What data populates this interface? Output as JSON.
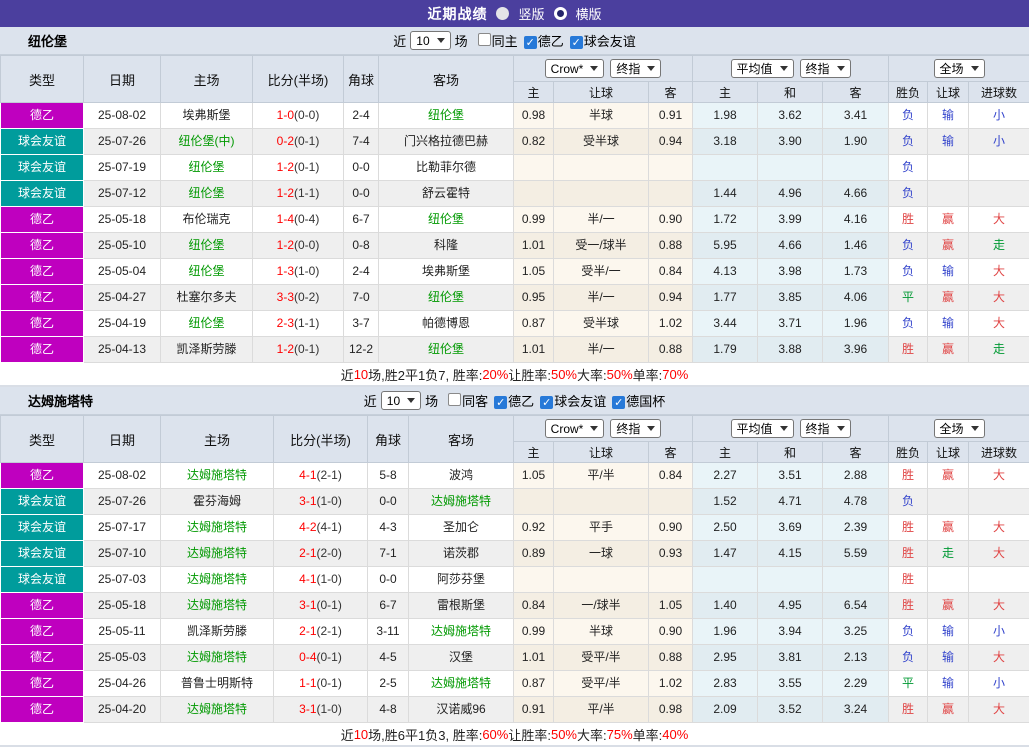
{
  "topbar": {
    "title": "近期战绩",
    "radios": [
      {
        "label": "竖版",
        "style": "solid"
      },
      {
        "label": "横版",
        "style": "ring"
      }
    ]
  },
  "colors": {
    "topbar_bg": "#4B3F9E",
    "league_badge": "#BF00BF",
    "friendly_badge": "#009C9C",
    "team_green": "#009900",
    "score_red": "#FF0000",
    "win_red": "#E04545",
    "lose_blue": "#3344CC",
    "draw_green": "#009933",
    "header_bg": "#DCE3ED",
    "odds_col_bg": "#FCF7EE",
    "avg_col_bg": "#E9F4F8"
  },
  "table_headers": {
    "left": [
      "类型",
      "日期",
      "主场",
      "比分(半场)",
      "角球",
      "客场"
    ],
    "odds_group": {
      "select1": "Crow*",
      "select2": "终指",
      "cols": [
        "主",
        "让球",
        "客"
      ]
    },
    "avg_group": {
      "select1": "平均值",
      "select2": "终指",
      "cols": [
        "主",
        "和",
        "客"
      ]
    },
    "result_group": {
      "select": "全场",
      "cols": [
        "胜负",
        "让球",
        "进球数"
      ]
    }
  },
  "sections": [
    {
      "title": "纽伦堡",
      "filter": {
        "prefix": "近",
        "count": "10",
        "suffix": "场",
        "checkboxes": [
          {
            "label": "同主",
            "checked": false
          },
          {
            "label": "德乙",
            "checked": true
          },
          {
            "label": "球会友谊",
            "checked": true
          }
        ]
      },
      "rows": [
        {
          "type": "德乙",
          "league_key": "league",
          "date": "25-08-02",
          "home": "埃弗斯堡",
          "home_active": false,
          "score": "1-0",
          "half": "(0-0)",
          "corners": "2-4",
          "away": "纽伦堡",
          "away_active": true,
          "odds": [
            "0.98",
            "半球",
            "0.91"
          ],
          "avgs": [
            "1.98",
            "3.62",
            "3.41"
          ],
          "results": [
            {
              "text": "负",
              "color": "blue"
            },
            {
              "text": "输",
              "color": "blue"
            },
            {
              "text": "小",
              "color": "blue"
            }
          ]
        },
        {
          "type": "球会友谊",
          "league_key": "friendly",
          "date": "25-07-26",
          "home": "纽伦堡(中)",
          "home_active": true,
          "score": "0-2",
          "half": "(0-1)",
          "corners": "7-4",
          "away": "门兴格拉德巴赫",
          "away_active": false,
          "odds": [
            "0.82",
            "受半球",
            "0.94"
          ],
          "avgs": [
            "3.18",
            "3.90",
            "1.90"
          ],
          "results": [
            {
              "text": "负",
              "color": "blue"
            },
            {
              "text": "输",
              "color": "blue"
            },
            {
              "text": "小",
              "color": "blue"
            }
          ]
        },
        {
          "type": "球会友谊",
          "league_key": "friendly",
          "date": "25-07-19",
          "home": "纽伦堡",
          "home_active": true,
          "score": "1-2",
          "half": "(0-1)",
          "corners": "0-0",
          "away": "比勒菲尔德",
          "away_active": false,
          "odds": [
            "",
            "",
            ""
          ],
          "avgs": [
            "",
            "",
            ""
          ],
          "results": [
            {
              "text": "负",
              "color": "blue"
            },
            {
              "text": "",
              "color": ""
            },
            {
              "text": "",
              "color": ""
            }
          ]
        },
        {
          "type": "球会友谊",
          "league_key": "friendly",
          "date": "25-07-12",
          "home": "纽伦堡",
          "home_active": true,
          "score": "1-2",
          "half": "(1-1)",
          "corners": "0-0",
          "away": "舒云霍特",
          "away_active": false,
          "odds": [
            "",
            "",
            ""
          ],
          "avgs": [
            "1.44",
            "4.96",
            "4.66"
          ],
          "results": [
            {
              "text": "负",
              "color": "blue"
            },
            {
              "text": "",
              "color": ""
            },
            {
              "text": "",
              "color": ""
            }
          ]
        },
        {
          "type": "德乙",
          "league_key": "league",
          "date": "25-05-18",
          "home": "布伦瑞克",
          "home_active": false,
          "score": "1-4",
          "half": "(0-4)",
          "corners": "6-7",
          "away": "纽伦堡",
          "away_active": true,
          "odds": [
            "0.99",
            "半/一",
            "0.90"
          ],
          "avgs": [
            "1.72",
            "3.99",
            "4.16"
          ],
          "results": [
            {
              "text": "胜",
              "color": "red"
            },
            {
              "text": "赢",
              "color": "red"
            },
            {
              "text": "大",
              "color": "red"
            }
          ]
        },
        {
          "type": "德乙",
          "league_key": "league",
          "date": "25-05-10",
          "home": "纽伦堡",
          "home_active": true,
          "score": "1-2",
          "half": "(0-0)",
          "corners": "0-8",
          "away": "科隆",
          "away_active": false,
          "odds": [
            "1.01",
            "受一/球半",
            "0.88"
          ],
          "avgs": [
            "5.95",
            "4.66",
            "1.46"
          ],
          "results": [
            {
              "text": "负",
              "color": "blue"
            },
            {
              "text": "赢",
              "color": "red"
            },
            {
              "text": "走",
              "color": "green"
            }
          ]
        },
        {
          "type": "德乙",
          "league_key": "league",
          "date": "25-05-04",
          "home": "纽伦堡",
          "home_active": true,
          "score": "1-3",
          "half": "(1-0)",
          "corners": "2-4",
          "away": "埃弗斯堡",
          "away_active": false,
          "odds": [
            "1.05",
            "受半/一",
            "0.84"
          ],
          "avgs": [
            "4.13",
            "3.98",
            "1.73"
          ],
          "results": [
            {
              "text": "负",
              "color": "blue"
            },
            {
              "text": "输",
              "color": "blue"
            },
            {
              "text": "大",
              "color": "red"
            }
          ]
        },
        {
          "type": "德乙",
          "league_key": "league",
          "date": "25-04-27",
          "home": "杜塞尔多夫",
          "home_active": false,
          "score": "3-3",
          "half": "(0-2)",
          "corners": "7-0",
          "away": "纽伦堡",
          "away_active": true,
          "odds": [
            "0.95",
            "半/一",
            "0.94"
          ],
          "avgs": [
            "1.77",
            "3.85",
            "4.06"
          ],
          "results": [
            {
              "text": "平",
              "color": "green"
            },
            {
              "text": "赢",
              "color": "red"
            },
            {
              "text": "大",
              "color": "red"
            }
          ]
        },
        {
          "type": "德乙",
          "league_key": "league",
          "date": "25-04-19",
          "home": "纽伦堡",
          "home_active": true,
          "score": "2-3",
          "half": "(1-1)",
          "corners": "3-7",
          "away": "帕德博恩",
          "away_active": false,
          "odds": [
            "0.87",
            "受半球",
            "1.02"
          ],
          "avgs": [
            "3.44",
            "3.71",
            "1.96"
          ],
          "results": [
            {
              "text": "负",
              "color": "blue"
            },
            {
              "text": "输",
              "color": "blue"
            },
            {
              "text": "大",
              "color": "red"
            }
          ]
        },
        {
          "type": "德乙",
          "league_key": "league",
          "date": "25-04-13",
          "home": "凯泽斯劳滕",
          "home_active": false,
          "score": "1-2",
          "half": "(0-1)",
          "corners": "12-2",
          "away": "纽伦堡",
          "away_active": true,
          "odds": [
            "1.01",
            "半/一",
            "0.88"
          ],
          "avgs": [
            "1.79",
            "3.88",
            "3.96"
          ],
          "results": [
            {
              "text": "胜",
              "color": "red"
            },
            {
              "text": "赢",
              "color": "red"
            },
            {
              "text": "走",
              "color": "green"
            }
          ]
        }
      ],
      "summary": [
        {
          "text": "近",
          "red": false
        },
        {
          "text": "10",
          "red": true
        },
        {
          "text": "场,胜2平1负7, 胜率:",
          "red": false
        },
        {
          "text": "20%",
          "red": true
        },
        {
          "text": " 让胜率:",
          "red": false
        },
        {
          "text": "50%",
          "red": true
        },
        {
          "text": " 大率:",
          "red": false
        },
        {
          "text": "50%",
          "red": true
        },
        {
          "text": " 单率:",
          "red": false
        },
        {
          "text": "70%",
          "red": true
        }
      ]
    },
    {
      "title": "达姆施塔特",
      "filter": {
        "prefix": "近",
        "count": "10",
        "suffix": "场",
        "checkboxes": [
          {
            "label": "同客",
            "checked": false
          },
          {
            "label": "德乙",
            "checked": true
          },
          {
            "label": "球会友谊",
            "checked": true
          },
          {
            "label": "德国杯",
            "checked": true
          }
        ]
      },
      "rows": [
        {
          "type": "德乙",
          "league_key": "league",
          "date": "25-08-02",
          "home": "达姆施塔特",
          "home_active": true,
          "score": "4-1",
          "half": "(2-1)",
          "corners": "5-8",
          "away": "波鸿",
          "away_active": false,
          "odds": [
            "1.05",
            "平/半",
            "0.84"
          ],
          "avgs": [
            "2.27",
            "3.51",
            "2.88"
          ],
          "results": [
            {
              "text": "胜",
              "color": "red"
            },
            {
              "text": "赢",
              "color": "red"
            },
            {
              "text": "大",
              "color": "red"
            }
          ]
        },
        {
          "type": "球会友谊",
          "league_key": "friendly",
          "date": "25-07-26",
          "home": "霍芬海姆",
          "home_active": false,
          "score": "3-1",
          "half": "(1-0)",
          "corners": "0-0",
          "away": "达姆施塔特",
          "away_active": true,
          "odds": [
            "",
            "",
            ""
          ],
          "avgs": [
            "1.52",
            "4.71",
            "4.78"
          ],
          "results": [
            {
              "text": "负",
              "color": "blue"
            },
            {
              "text": "",
              "color": ""
            },
            {
              "text": "",
              "color": ""
            }
          ]
        },
        {
          "type": "球会友谊",
          "league_key": "friendly",
          "date": "25-07-17",
          "home": "达姆施塔特",
          "home_active": true,
          "score": "4-2",
          "half": "(4-1)",
          "corners": "4-3",
          "away": "圣加仑",
          "away_active": false,
          "odds": [
            "0.92",
            "平手",
            "0.90"
          ],
          "avgs": [
            "2.50",
            "3.69",
            "2.39"
          ],
          "results": [
            {
              "text": "胜",
              "color": "red"
            },
            {
              "text": "赢",
              "color": "red"
            },
            {
              "text": "大",
              "color": "red"
            }
          ]
        },
        {
          "type": "球会友谊",
          "league_key": "friendly",
          "date": "25-07-10",
          "home": "达姆施塔特",
          "home_active": true,
          "score": "2-1",
          "half": "(2-0)",
          "corners": "7-1",
          "away": "诺茨郡",
          "away_active": false,
          "odds": [
            "0.89",
            "一球",
            "0.93"
          ],
          "avgs": [
            "1.47",
            "4.15",
            "5.59"
          ],
          "results": [
            {
              "text": "胜",
              "color": "red"
            },
            {
              "text": "走",
              "color": "green"
            },
            {
              "text": "大",
              "color": "red"
            }
          ]
        },
        {
          "type": "球会友谊",
          "league_key": "friendly",
          "date": "25-07-03",
          "home": "达姆施塔特",
          "home_active": true,
          "score": "4-1",
          "half": "(1-0)",
          "corners": "0-0",
          "away": "阿莎芬堡",
          "away_active": false,
          "odds": [
            "",
            "",
            ""
          ],
          "avgs": [
            "",
            "",
            ""
          ],
          "results": [
            {
              "text": "胜",
              "color": "red"
            },
            {
              "text": "",
              "color": ""
            },
            {
              "text": "",
              "color": ""
            }
          ]
        },
        {
          "type": "德乙",
          "league_key": "league",
          "date": "25-05-18",
          "home": "达姆施塔特",
          "home_active": true,
          "score": "3-1",
          "half": "(0-1)",
          "corners": "6-7",
          "away": "雷根斯堡",
          "away_active": false,
          "odds": [
            "0.84",
            "一/球半",
            "1.05"
          ],
          "avgs": [
            "1.40",
            "4.95",
            "6.54"
          ],
          "results": [
            {
              "text": "胜",
              "color": "red"
            },
            {
              "text": "赢",
              "color": "red"
            },
            {
              "text": "大",
              "color": "red"
            }
          ]
        },
        {
          "type": "德乙",
          "league_key": "league",
          "date": "25-05-11",
          "home": "凯泽斯劳滕",
          "home_active": false,
          "score": "2-1",
          "half": "(2-1)",
          "corners": "3-11",
          "away": "达姆施塔特",
          "away_active": true,
          "odds": [
            "0.99",
            "半球",
            "0.90"
          ],
          "avgs": [
            "1.96",
            "3.94",
            "3.25"
          ],
          "results": [
            {
              "text": "负",
              "color": "blue"
            },
            {
              "text": "输",
              "color": "blue"
            },
            {
              "text": "小",
              "color": "blue"
            }
          ]
        },
        {
          "type": "德乙",
          "league_key": "league",
          "date": "25-05-03",
          "home": "达姆施塔特",
          "home_active": true,
          "score": "0-4",
          "half": "(0-1)",
          "corners": "4-5",
          "away": "汉堡",
          "away_active": false,
          "odds": [
            "1.01",
            "受平/半",
            "0.88"
          ],
          "avgs": [
            "2.95",
            "3.81",
            "2.13"
          ],
          "results": [
            {
              "text": "负",
              "color": "blue"
            },
            {
              "text": "输",
              "color": "blue"
            },
            {
              "text": "大",
              "color": "red"
            }
          ]
        },
        {
          "type": "德乙",
          "league_key": "league",
          "date": "25-04-26",
          "home": "普鲁士明斯特",
          "home_active": false,
          "score": "1-1",
          "half": "(0-1)",
          "corners": "2-5",
          "away": "达姆施塔特",
          "away_active": true,
          "odds": [
            "0.87",
            "受平/半",
            "1.02"
          ],
          "avgs": [
            "2.83",
            "3.55",
            "2.29"
          ],
          "results": [
            {
              "text": "平",
              "color": "green"
            },
            {
              "text": "输",
              "color": "blue"
            },
            {
              "text": "小",
              "color": "blue"
            }
          ]
        },
        {
          "type": "德乙",
          "league_key": "league",
          "date": "25-04-20",
          "home": "达姆施塔特",
          "home_active": true,
          "score": "3-1",
          "half": "(1-0)",
          "corners": "4-8",
          "away": "汉诺威96",
          "away_active": false,
          "odds": [
            "0.91",
            "平/半",
            "0.98"
          ],
          "avgs": [
            "2.09",
            "3.52",
            "3.24"
          ],
          "results": [
            {
              "text": "胜",
              "color": "red"
            },
            {
              "text": "赢",
              "color": "red"
            },
            {
              "text": "大",
              "color": "red"
            }
          ]
        }
      ],
      "summary": [
        {
          "text": "近",
          "red": false
        },
        {
          "text": "10",
          "red": true
        },
        {
          "text": "场,胜6平1负3, 胜率:",
          "red": false
        },
        {
          "text": "60%",
          "red": true
        },
        {
          "text": " 让胜率:",
          "red": false
        },
        {
          "text": "50%",
          "red": true
        },
        {
          "text": " 大率:",
          "red": false
        },
        {
          "text": "75%",
          "red": true
        },
        {
          "text": " 单率:",
          "red": false
        },
        {
          "text": "40%",
          "red": true
        }
      ]
    }
  ]
}
